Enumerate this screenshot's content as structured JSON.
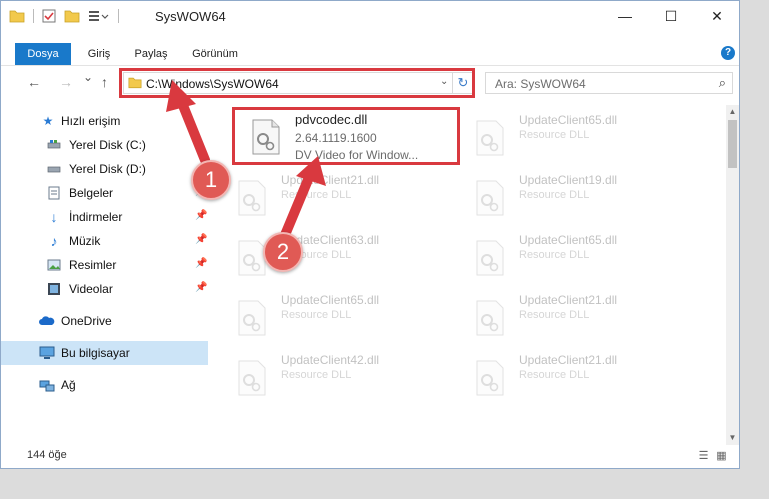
{
  "window": {
    "title": "SysWOW64",
    "minimize": "—",
    "maximize": "☐",
    "close": "✕"
  },
  "ribbon": {
    "tabs": [
      "Dosya",
      "Giriş",
      "Paylaş",
      "Görünüm"
    ],
    "help": "?"
  },
  "nav": {
    "back": "←",
    "forward": "→",
    "recent": "⌄",
    "up": "↑",
    "address": "C:\\Windows\\SysWOW64",
    "address_drop": "⌄",
    "refresh": "↻",
    "search_placeholder": "Ara: SysWOW64",
    "search_icon": "⌕"
  },
  "sidebar": {
    "items": [
      {
        "label": "Hızlı erişim",
        "icon": "star-icon"
      },
      {
        "label": "Yerel Disk (C:)",
        "icon": "drive-icon"
      },
      {
        "label": "Yerel Disk (D:)",
        "icon": "drive-icon"
      },
      {
        "label": "Belgeler",
        "icon": "documents-icon"
      },
      {
        "label": "İndirmeler",
        "icon": "download-icon"
      },
      {
        "label": "Müzik",
        "icon": "music-icon"
      },
      {
        "label": "Resimler",
        "icon": "pictures-icon"
      },
      {
        "label": "Videolar",
        "icon": "video-icon"
      },
      {
        "label": "OneDrive",
        "icon": "cloud-icon"
      },
      {
        "label": "Bu bilgisayar",
        "icon": "computer-icon"
      },
      {
        "label": "Ağ",
        "icon": "network-icon"
      }
    ],
    "pin": "📌"
  },
  "files": {
    "highlighted": {
      "name": "pdvcodec.dll",
      "version": "2.64.1119.1600",
      "description": "DV Video for Window..."
    },
    "left_column": [
      {
        "name": "UpdateClient21.dll",
        "type": "Resource DLL"
      },
      {
        "name": "UpdateClient63.dll",
        "type": "Resource DLL"
      },
      {
        "name": "UpdateClient65.dll",
        "type": "Resource DLL"
      },
      {
        "name": "UpdateClient42.dll",
        "type": "Resource DLL"
      }
    ],
    "right_column": [
      {
        "name": "UpdateClient65.dll",
        "type": "Resource DLL"
      },
      {
        "name": "UpdateClient19.dll",
        "type": "Resource DLL"
      },
      {
        "name": "UpdateClient65.dll",
        "type": "Resource DLL"
      },
      {
        "name": "UpdateClient21.dll",
        "type": "Resource DLL"
      },
      {
        "name": "UpdateClient21.dll",
        "type": "Resource DLL"
      }
    ]
  },
  "status": {
    "count": "144 öğe"
  },
  "annotations": {
    "badge1": "1",
    "badge2": "2",
    "color": "#d9393f"
  }
}
